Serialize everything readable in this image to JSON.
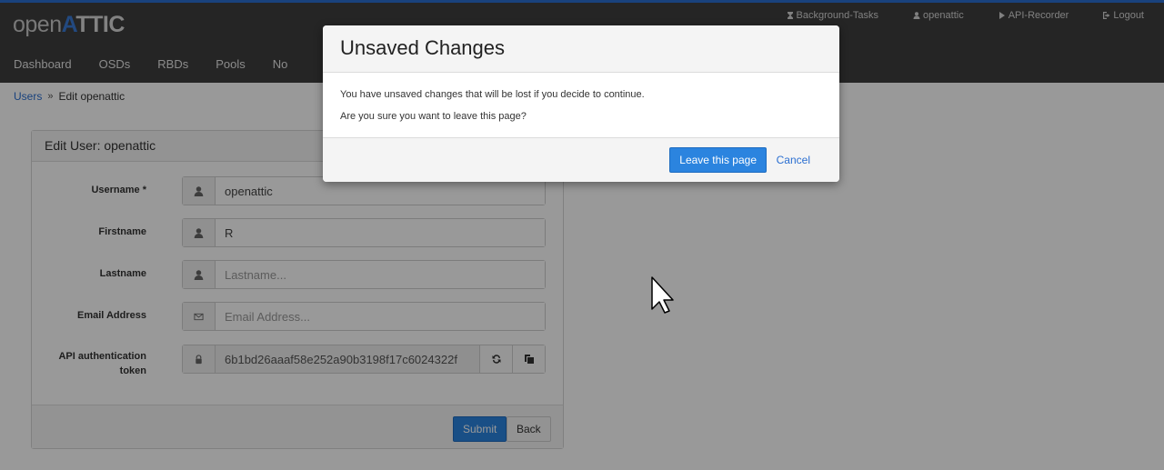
{
  "app": {
    "logo_open": "open",
    "logo_attic_a": "A",
    "logo_attic_rest": "TTIC"
  },
  "toplinks": [
    {
      "label": "Background-Tasks",
      "icon": "hourglass-icon"
    },
    {
      "label": "openattic",
      "icon": "user-icon"
    },
    {
      "label": "API-Recorder",
      "icon": "play-icon"
    },
    {
      "label": "Logout",
      "icon": "logout-icon"
    }
  ],
  "nav": [
    "Dashboard",
    "OSDs",
    "RBDs",
    "Pools",
    "No"
  ],
  "breadcrumb": {
    "link": "Users",
    "separator": "»",
    "current": "Edit openattic"
  },
  "panel": {
    "title": "Edit User: openattic",
    "fields": [
      {
        "label": "Username *",
        "value": "openattic",
        "placeholder": "",
        "icon": "user-icon"
      },
      {
        "label": "Firstname",
        "value": "R",
        "placeholder": "",
        "icon": "user-icon"
      },
      {
        "label": "Lastname",
        "value": "",
        "placeholder": "Lastname...",
        "icon": "user-icon"
      },
      {
        "label": "Email Address",
        "value": "",
        "placeholder": "Email Address...",
        "icon": "envelope-icon"
      },
      {
        "label_line1": "API authentication",
        "label_line2": "token",
        "value": "6b1bd26aaaf58e252a90b3198f17c6024322f",
        "icon": "lock-icon"
      }
    ],
    "submit_label": "Submit",
    "back_label": "Back"
  },
  "modal": {
    "title": "Unsaved Changes",
    "line1": "You have unsaved changes that will be lost if you decide to continue.",
    "line2": "Are you sure you want to leave this page?",
    "confirm_label": "Leave this page",
    "cancel_label": "Cancel"
  },
  "colors": {
    "accent": "#2b84df",
    "navbar": "#3f3f3f",
    "overlay": "rgba(0,0,0,0.4)"
  }
}
